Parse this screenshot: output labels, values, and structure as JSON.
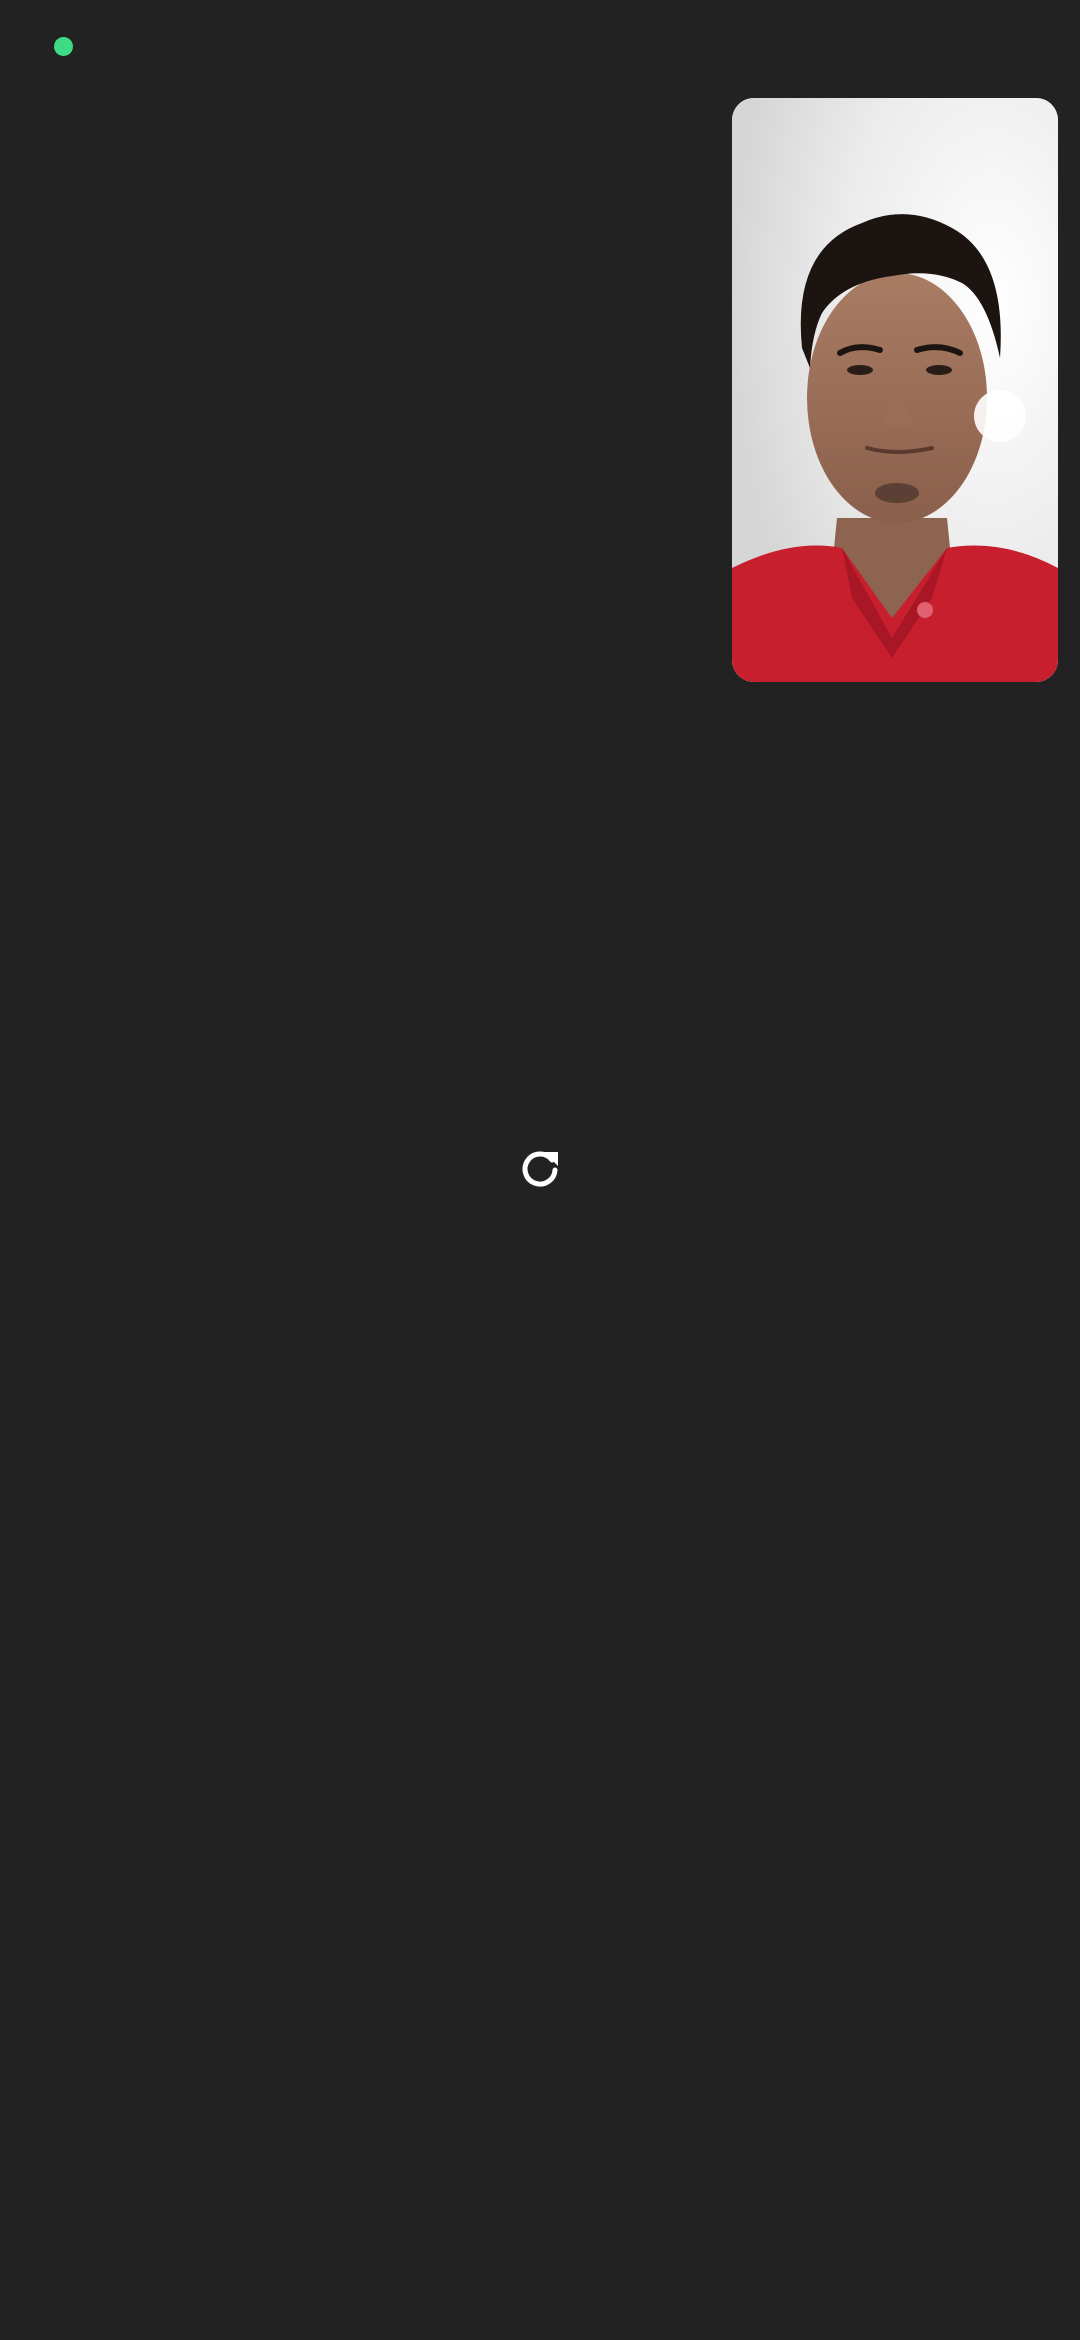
{
  "status": {
    "indicator_color": "#3ddc84"
  },
  "self_view": {
    "icon": "camera-preview"
  },
  "controls": {
    "refresh_icon": "refresh-icon",
    "icon_color": "#ffffff"
  },
  "theme": {
    "background": "#222222"
  }
}
